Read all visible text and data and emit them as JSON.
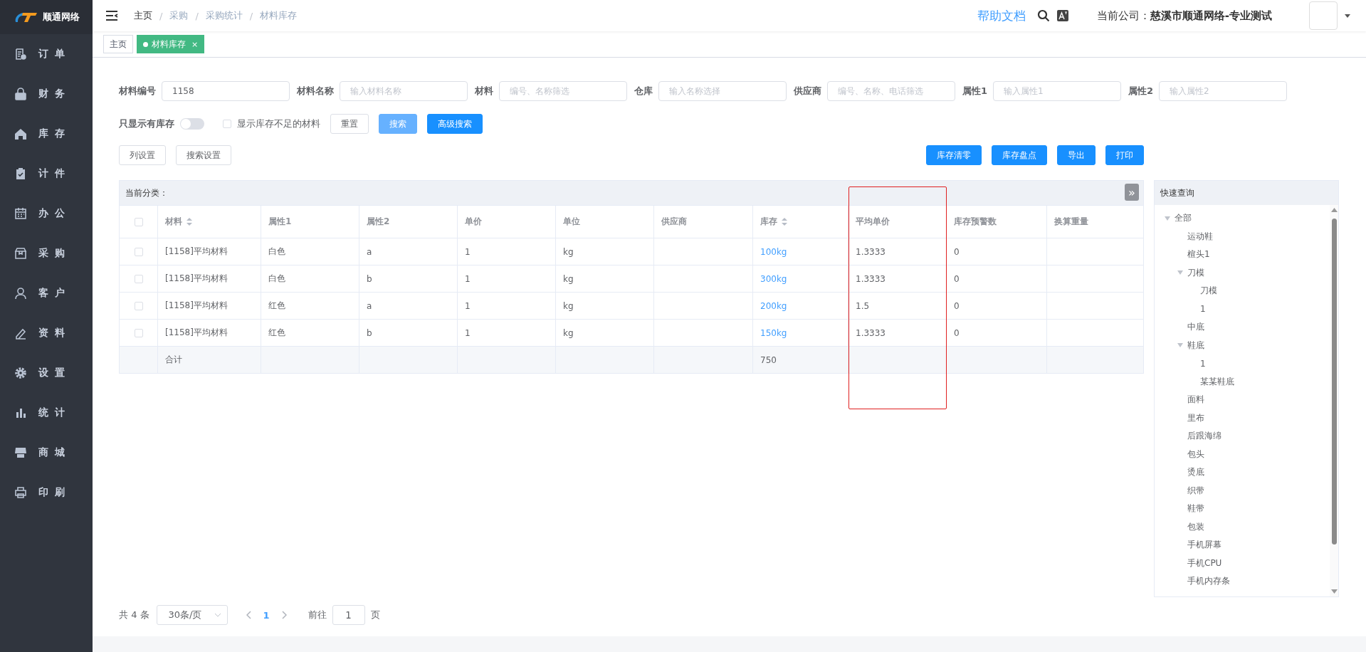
{
  "logo": {
    "text": "顺通网络"
  },
  "sidebar": {
    "items": [
      {
        "label": "订 单"
      },
      {
        "label": "财 务"
      },
      {
        "label": "库 存"
      },
      {
        "label": "计 件"
      },
      {
        "label": "办 公"
      },
      {
        "label": "采 购"
      },
      {
        "label": "客 户"
      },
      {
        "label": "资 料"
      },
      {
        "label": "设 置"
      },
      {
        "label": "统 计"
      },
      {
        "label": "商 城"
      },
      {
        "label": "印 刷"
      }
    ]
  },
  "breadcrumb": {
    "separator": "/",
    "items": [
      "主页",
      "采购",
      "采购统计",
      "材料库存"
    ]
  },
  "header": {
    "help": "帮助文档",
    "company": "当前公司：**慈溪市顺通网络-专业测试**"
  },
  "tabs": [
    {
      "label": "主页",
      "selected": false,
      "closable": false
    },
    {
      "label": "材料库存",
      "selected": true,
      "closable": true,
      "close": "×"
    }
  ],
  "filters": [
    {
      "label": "材料编号",
      "value": "1158"
    },
    {
      "label": "材料名称",
      "placeholder": "输入材料名称"
    },
    {
      "label": "材料",
      "placeholder": "编号、名称筛选"
    },
    {
      "label": "仓库",
      "placeholder": "输入名称选择"
    },
    {
      "label": "供应商",
      "placeholder": "编号、名称、电话筛选"
    },
    {
      "label": "属性1",
      "placeholder": "输入属性1"
    },
    {
      "label": "属性2",
      "placeholder": "输入属性2"
    }
  ],
  "stock_only": {
    "label": "只显示有库存",
    "on": false
  },
  "show_shortage": {
    "label": "显示库存不足的材料",
    "checked": false
  },
  "filter_buttons": [
    {
      "label": "重置",
      "kind": "plain"
    },
    {
      "label": "搜索",
      "kind": "light"
    },
    {
      "label": "高级搜索",
      "kind": "primary"
    }
  ],
  "settings_buttons": [
    "列设置",
    "搜索设置"
  ],
  "action_buttons": [
    "库存清零",
    "库存盘点",
    "导出",
    "打印"
  ],
  "table": {
    "category_label": "当前分类：",
    "collapse_icon": "»",
    "all_selected": false,
    "columns": [
      {
        "label": "材料",
        "sortable": true,
        "kind": "text",
        "highlighted": false
      },
      {
        "label": "属性1",
        "sortable": false,
        "kind": "text",
        "highlighted": false
      },
      {
        "label": "属性2",
        "sortable": false,
        "kind": "text",
        "highlighted": false
      },
      {
        "label": "单价",
        "sortable": false,
        "kind": "text",
        "highlighted": false
      },
      {
        "label": "单位",
        "sortable": false,
        "kind": "text",
        "highlighted": false
      },
      {
        "label": "供应商",
        "sortable": false,
        "kind": "text",
        "highlighted": false
      },
      {
        "label": "库存",
        "sortable": true,
        "kind": "link",
        "highlighted": false
      },
      {
        "label": "平均单价",
        "sortable": false,
        "kind": "text",
        "highlighted": true
      },
      {
        "label": "库存预警数",
        "sortable": false,
        "kind": "text",
        "highlighted": false
      },
      {
        "label": "换算重量",
        "sortable": false,
        "kind": "text",
        "highlighted": false
      }
    ],
    "rows": [
      {
        "selected": false,
        "cells": [
          "[1158]平均材料",
          "白色",
          "a",
          "1",
          "kg",
          null,
          "100kg",
          "1.3333",
          "0",
          null
        ]
      },
      {
        "selected": false,
        "cells": [
          "[1158]平均材料",
          "白色",
          "b",
          "1",
          "kg",
          null,
          "300kg",
          "1.3333",
          "0",
          null
        ]
      },
      {
        "selected": false,
        "cells": [
          "[1158]平均材料",
          "红色",
          "a",
          "1",
          "kg",
          null,
          "200kg",
          "1.5",
          "0",
          null
        ]
      },
      {
        "selected": false,
        "cells": [
          "[1158]平均材料",
          "红色",
          "b",
          "1",
          "kg",
          null,
          "150kg",
          "1.3333",
          "0",
          null
        ]
      }
    ],
    "total": {
      "label": "合计",
      "stock": "750"
    }
  },
  "quick_search": {
    "title": "快速查询",
    "tree": [
      {
        "label": "全部",
        "expanded": true,
        "children": [
          {
            "label": "运动鞋"
          },
          {
            "label": "楦头1"
          },
          {
            "label": "刀模",
            "expanded": true,
            "children": [
              {
                "label": "刀模"
              },
              {
                "label": "1"
              }
            ]
          },
          {
            "label": "中底"
          },
          {
            "label": "鞋底",
            "expanded": true,
            "children": [
              {
                "label": "1"
              },
              {
                "label": "某某鞋底"
              }
            ]
          },
          {
            "label": "面料"
          },
          {
            "label": "里布"
          },
          {
            "label": "后跟海绵"
          },
          {
            "label": "包头"
          },
          {
            "label": "烫底"
          },
          {
            "label": "织带"
          },
          {
            "label": "鞋带"
          },
          {
            "label": "包装"
          },
          {
            "label": "手机屏幕"
          },
          {
            "label": "手机CPU"
          },
          {
            "label": "手机内存条"
          }
        ]
      }
    ]
  },
  "pagination": {
    "total": "共 4 条",
    "page_size": "30条/页",
    "pages": [
      {
        "label": "1",
        "selected": true
      }
    ],
    "goto_label": "前往",
    "goto_value": "1",
    "goto_suffix": "页"
  }
}
